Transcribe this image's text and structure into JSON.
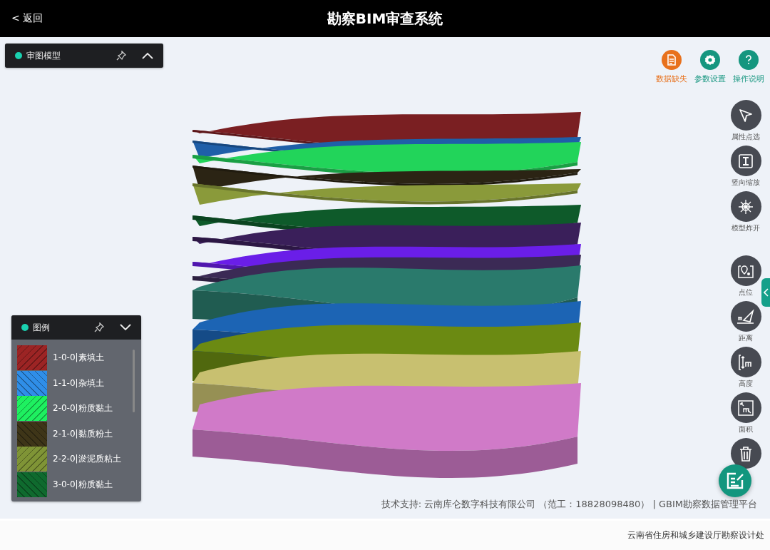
{
  "header": {
    "back": "< 返回",
    "title": "勘察BIM审查系统"
  },
  "model_panel": {
    "title": "审图模型",
    "expanded": false
  },
  "top_actions": [
    {
      "label": "数据缺失",
      "kind": "doc",
      "color": "#e8711c"
    },
    {
      "label": "参数设置",
      "kind": "gear",
      "color": "#15967f"
    },
    {
      "label": "操作说明",
      "kind": "help",
      "color": "#15967f"
    }
  ],
  "tools": [
    {
      "label": "属性点选",
      "kind": "pointer"
    },
    {
      "label": "竖向缩放",
      "kind": "vscale"
    },
    {
      "label": "模型炸开",
      "kind": "explode"
    },
    {
      "label": "点位",
      "kind": "point"
    },
    {
      "label": "距离",
      "kind": "distance"
    },
    {
      "label": "高度",
      "kind": "height"
    },
    {
      "label": "面积",
      "kind": "area"
    },
    {
      "kind": "trash"
    }
  ],
  "legend": {
    "title": "图例",
    "expanded": true,
    "items": [
      {
        "label": "1-0-0|素填土",
        "color": "#9c2424"
      },
      {
        "label": "1-1-0|杂填土",
        "color": "#2f8ee8"
      },
      {
        "label": "2-0-0|粉质黏土",
        "color": "#1ef060"
      },
      {
        "label": "2-1-0|黏质粉土",
        "color": "#3e3518"
      },
      {
        "label": "2-2-0|淤泥质粘土",
        "color": "#7f9436"
      },
      {
        "label": "3-0-0|粉质黏土",
        "color": "#0f6a2e"
      }
    ]
  },
  "credit": "技术支持: 云南库仑数字科技有限公司 （范工：18828098480） | GBIM勘察数据管理平台",
  "footer": "云南省住房和城乡建设厅勘察设计处"
}
